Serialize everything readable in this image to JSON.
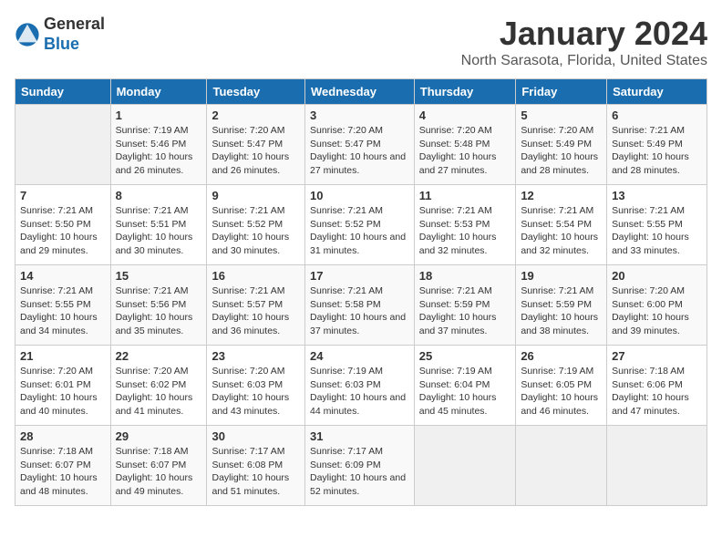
{
  "header": {
    "logo_line1": "General",
    "logo_line2": "Blue",
    "title": "January 2024",
    "subtitle": "North Sarasota, Florida, United States"
  },
  "weekdays": [
    "Sunday",
    "Monday",
    "Tuesday",
    "Wednesday",
    "Thursday",
    "Friday",
    "Saturday"
  ],
  "weeks": [
    [
      {
        "day": "",
        "empty": true
      },
      {
        "day": "1",
        "sunrise": "Sunrise: 7:19 AM",
        "sunset": "Sunset: 5:46 PM",
        "daylight": "Daylight: 10 hours and 26 minutes."
      },
      {
        "day": "2",
        "sunrise": "Sunrise: 7:20 AM",
        "sunset": "Sunset: 5:47 PM",
        "daylight": "Daylight: 10 hours and 26 minutes."
      },
      {
        "day": "3",
        "sunrise": "Sunrise: 7:20 AM",
        "sunset": "Sunset: 5:47 PM",
        "daylight": "Daylight: 10 hours and 27 minutes."
      },
      {
        "day": "4",
        "sunrise": "Sunrise: 7:20 AM",
        "sunset": "Sunset: 5:48 PM",
        "daylight": "Daylight: 10 hours and 27 minutes."
      },
      {
        "day": "5",
        "sunrise": "Sunrise: 7:20 AM",
        "sunset": "Sunset: 5:49 PM",
        "daylight": "Daylight: 10 hours and 28 minutes."
      },
      {
        "day": "6",
        "sunrise": "Sunrise: 7:21 AM",
        "sunset": "Sunset: 5:49 PM",
        "daylight": "Daylight: 10 hours and 28 minutes."
      }
    ],
    [
      {
        "day": "7",
        "sunrise": "Sunrise: 7:21 AM",
        "sunset": "Sunset: 5:50 PM",
        "daylight": "Daylight: 10 hours and 29 minutes."
      },
      {
        "day": "8",
        "sunrise": "Sunrise: 7:21 AM",
        "sunset": "Sunset: 5:51 PM",
        "daylight": "Daylight: 10 hours and 30 minutes."
      },
      {
        "day": "9",
        "sunrise": "Sunrise: 7:21 AM",
        "sunset": "Sunset: 5:52 PM",
        "daylight": "Daylight: 10 hours and 30 minutes."
      },
      {
        "day": "10",
        "sunrise": "Sunrise: 7:21 AM",
        "sunset": "Sunset: 5:52 PM",
        "daylight": "Daylight: 10 hours and 31 minutes."
      },
      {
        "day": "11",
        "sunrise": "Sunrise: 7:21 AM",
        "sunset": "Sunset: 5:53 PM",
        "daylight": "Daylight: 10 hours and 32 minutes."
      },
      {
        "day": "12",
        "sunrise": "Sunrise: 7:21 AM",
        "sunset": "Sunset: 5:54 PM",
        "daylight": "Daylight: 10 hours and 32 minutes."
      },
      {
        "day": "13",
        "sunrise": "Sunrise: 7:21 AM",
        "sunset": "Sunset: 5:55 PM",
        "daylight": "Daylight: 10 hours and 33 minutes."
      }
    ],
    [
      {
        "day": "14",
        "sunrise": "Sunrise: 7:21 AM",
        "sunset": "Sunset: 5:55 PM",
        "daylight": "Daylight: 10 hours and 34 minutes."
      },
      {
        "day": "15",
        "sunrise": "Sunrise: 7:21 AM",
        "sunset": "Sunset: 5:56 PM",
        "daylight": "Daylight: 10 hours and 35 minutes."
      },
      {
        "day": "16",
        "sunrise": "Sunrise: 7:21 AM",
        "sunset": "Sunset: 5:57 PM",
        "daylight": "Daylight: 10 hours and 36 minutes."
      },
      {
        "day": "17",
        "sunrise": "Sunrise: 7:21 AM",
        "sunset": "Sunset: 5:58 PM",
        "daylight": "Daylight: 10 hours and 37 minutes."
      },
      {
        "day": "18",
        "sunrise": "Sunrise: 7:21 AM",
        "sunset": "Sunset: 5:59 PM",
        "daylight": "Daylight: 10 hours and 37 minutes."
      },
      {
        "day": "19",
        "sunrise": "Sunrise: 7:21 AM",
        "sunset": "Sunset: 5:59 PM",
        "daylight": "Daylight: 10 hours and 38 minutes."
      },
      {
        "day": "20",
        "sunrise": "Sunrise: 7:20 AM",
        "sunset": "Sunset: 6:00 PM",
        "daylight": "Daylight: 10 hours and 39 minutes."
      }
    ],
    [
      {
        "day": "21",
        "sunrise": "Sunrise: 7:20 AM",
        "sunset": "Sunset: 6:01 PM",
        "daylight": "Daylight: 10 hours and 40 minutes."
      },
      {
        "day": "22",
        "sunrise": "Sunrise: 7:20 AM",
        "sunset": "Sunset: 6:02 PM",
        "daylight": "Daylight: 10 hours and 41 minutes."
      },
      {
        "day": "23",
        "sunrise": "Sunrise: 7:20 AM",
        "sunset": "Sunset: 6:03 PM",
        "daylight": "Daylight: 10 hours and 43 minutes."
      },
      {
        "day": "24",
        "sunrise": "Sunrise: 7:19 AM",
        "sunset": "Sunset: 6:03 PM",
        "daylight": "Daylight: 10 hours and 44 minutes."
      },
      {
        "day": "25",
        "sunrise": "Sunrise: 7:19 AM",
        "sunset": "Sunset: 6:04 PM",
        "daylight": "Daylight: 10 hours and 45 minutes."
      },
      {
        "day": "26",
        "sunrise": "Sunrise: 7:19 AM",
        "sunset": "Sunset: 6:05 PM",
        "daylight": "Daylight: 10 hours and 46 minutes."
      },
      {
        "day": "27",
        "sunrise": "Sunrise: 7:18 AM",
        "sunset": "Sunset: 6:06 PM",
        "daylight": "Daylight: 10 hours and 47 minutes."
      }
    ],
    [
      {
        "day": "28",
        "sunrise": "Sunrise: 7:18 AM",
        "sunset": "Sunset: 6:07 PM",
        "daylight": "Daylight: 10 hours and 48 minutes."
      },
      {
        "day": "29",
        "sunrise": "Sunrise: 7:18 AM",
        "sunset": "Sunset: 6:07 PM",
        "daylight": "Daylight: 10 hours and 49 minutes."
      },
      {
        "day": "30",
        "sunrise": "Sunrise: 7:17 AM",
        "sunset": "Sunset: 6:08 PM",
        "daylight": "Daylight: 10 hours and 51 minutes."
      },
      {
        "day": "31",
        "sunrise": "Sunrise: 7:17 AM",
        "sunset": "Sunset: 6:09 PM",
        "daylight": "Daylight: 10 hours and 52 minutes."
      },
      {
        "day": "",
        "empty": true
      },
      {
        "day": "",
        "empty": true
      },
      {
        "day": "",
        "empty": true
      }
    ]
  ]
}
